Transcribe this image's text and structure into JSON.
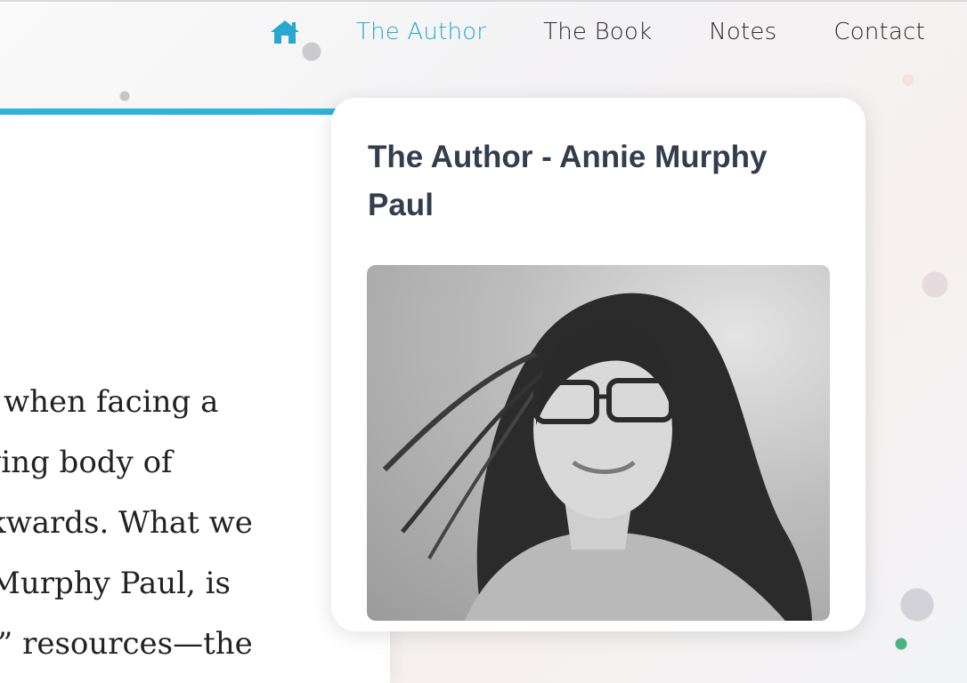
{
  "nav": {
    "home_icon": "home-icon",
    "items": [
      {
        "label": "The Author",
        "active": true
      },
      {
        "label": "The Book",
        "active": false
      },
      {
        "label": "Notes",
        "active": false
      },
      {
        "label": "Contact",
        "active": false
      }
    ]
  },
  "colors": {
    "accent": "#2aa7cf",
    "rule": "#2fb3d9",
    "title": "#333d4e"
  },
  "body_text": {
    "lines": [
      "when facing a",
      "ving body of",
      "kwards. What we",
      "Murphy Paul, is",
      "l” resources—the"
    ]
  },
  "card": {
    "title": "The Author - Annie Murphy Paul"
  }
}
